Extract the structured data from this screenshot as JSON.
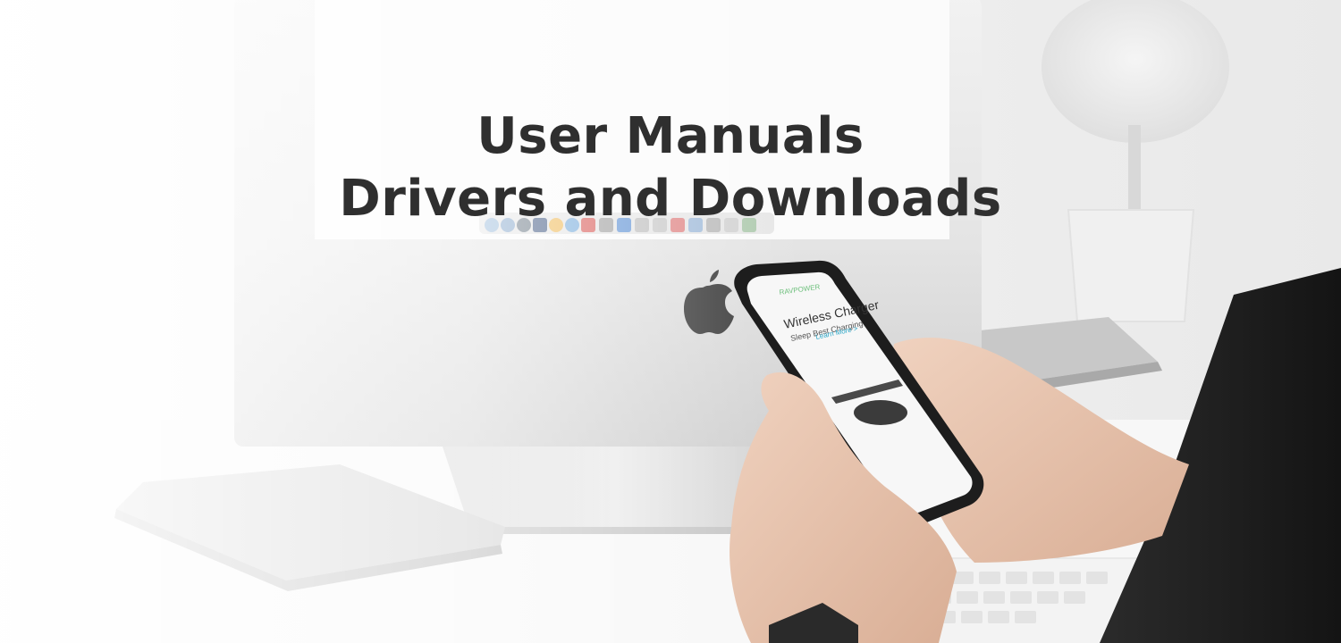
{
  "banner": {
    "title_line1": "User Manuals",
    "title_line2": "Drivers and Downloads"
  },
  "phone_screen": {
    "brand": "RAVPOWER",
    "headline": "Wireless Charger",
    "subline": "Sleep Best Charging",
    "link": "Learn More >"
  },
  "colors": {
    "headline_text": "#2f2f2f",
    "background": "#f2f2f2",
    "accent_link": "#2aa6c7",
    "brand_green": "#6bbf7a"
  }
}
